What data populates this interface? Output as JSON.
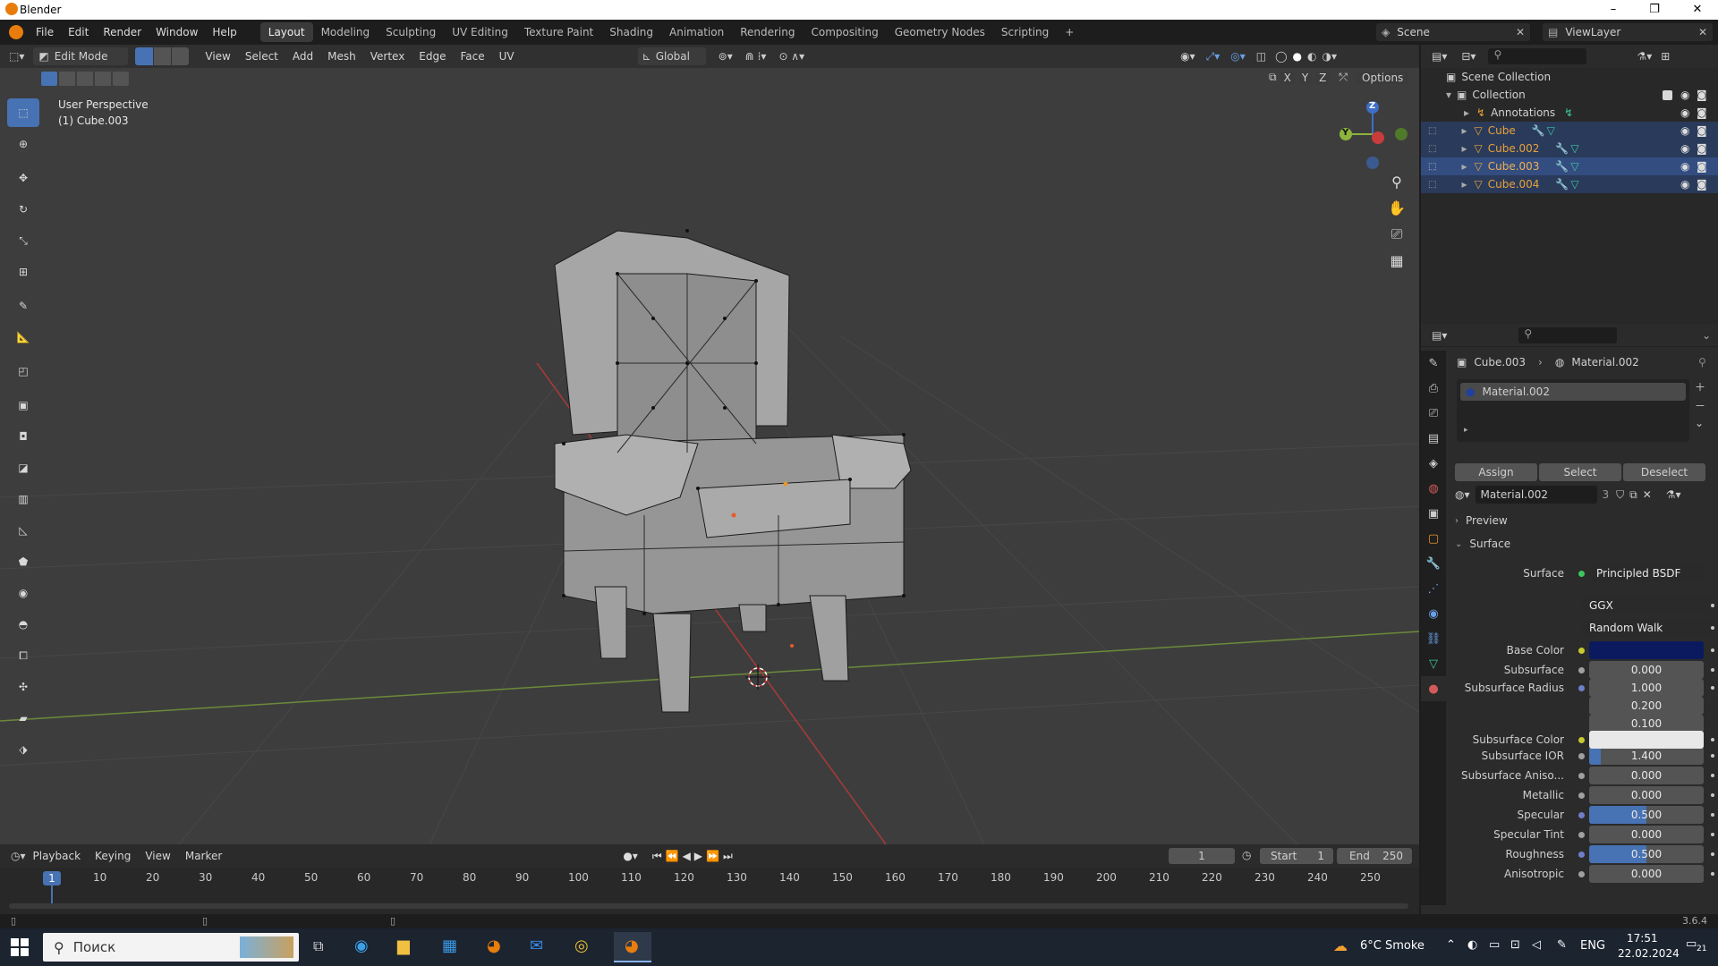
{
  "window": {
    "title": "Blender",
    "controls": [
      "–",
      "❐",
      "✕"
    ]
  },
  "menubar": {
    "menus": [
      "File",
      "Edit",
      "Render",
      "Window",
      "Help"
    ],
    "workspaces": [
      "Layout",
      "Modeling",
      "Sculpting",
      "UV Editing",
      "Texture Paint",
      "Shading",
      "Animation",
      "Rendering",
      "Compositing",
      "Geometry Nodes",
      "Scripting"
    ],
    "active_workspace": "Layout",
    "add_tab": "+",
    "scene": "Scene",
    "view_layer": "ViewLayer"
  },
  "viewport_header": {
    "mode": "Edit Mode",
    "menus": [
      "View",
      "Select",
      "Add",
      "Mesh",
      "Vertex",
      "Edge",
      "Face",
      "UV"
    ],
    "orientation": "Global",
    "options": "Options",
    "axes": [
      "X",
      "Y",
      "Z"
    ]
  },
  "viewport": {
    "perspective": "User Perspective",
    "object": "(1) Cube.003",
    "gizmo": {
      "z": "Z",
      "y": "Y"
    }
  },
  "outliner": {
    "root": "Scene Collection",
    "collection": "Collection",
    "items": [
      {
        "name": "Annotations",
        "color": "#d0d0d0",
        "selected": false
      },
      {
        "name": "Cube",
        "color": "#e8a23a",
        "selected": true
      },
      {
        "name": "Cube.002",
        "color": "#e8a23a",
        "selected": true
      },
      {
        "name": "Cube.003",
        "color": "#e8a23a",
        "selected": true,
        "active": true
      },
      {
        "name": "Cube.004",
        "color": "#e8a23a",
        "selected": true
      }
    ]
  },
  "properties": {
    "breadcrumb_object": "Cube.003",
    "breadcrumb_material": "Material.002",
    "slot": "Material.002",
    "buttons": [
      "Assign",
      "Select",
      "Deselect"
    ],
    "material_name": "Material.002",
    "users": "3",
    "panels": {
      "preview": "Preview",
      "surface": "Surface"
    },
    "surface_label": "Surface",
    "surface_shader": "Principled BSDF",
    "distribution": "GGX",
    "subsurface_method": "Random Walk",
    "base_color_label": "Base Color",
    "base_color": "#0b1a5e",
    "subsurface_color_label": "Subsurface Color",
    "subsurface_color": "#e8e8e8",
    "fields": [
      {
        "label": "Subsurface",
        "value": "0.000",
        "fill": 0
      },
      {
        "label": "Subsurface Radius",
        "value": "1.000",
        "fill": 0,
        "dot": "b"
      },
      {
        "label": "",
        "value": "0.200",
        "fill": 0
      },
      {
        "label": "",
        "value": "0.100",
        "fill": 0
      },
      {
        "label": "Subsurface IOR",
        "value": "1.400",
        "fill": 0.1
      },
      {
        "label": "Subsurface Aniso...",
        "value": "0.000",
        "fill": 0
      },
      {
        "label": "Metallic",
        "value": "0.000",
        "fill": 0
      },
      {
        "label": "Specular",
        "value": "0.500",
        "fill": 0.5,
        "dot": "b"
      },
      {
        "label": "Specular Tint",
        "value": "0.000",
        "fill": 0
      },
      {
        "label": "Roughness",
        "value": "0.500",
        "fill": 0.5,
        "dot": "b"
      },
      {
        "label": "Anisotropic",
        "value": "0.000",
        "fill": 0
      }
    ]
  },
  "timeline": {
    "menus": [
      "Playback",
      "Keying",
      "View",
      "Marker"
    ],
    "current_frame": "1",
    "start_label": "Start",
    "start": "1",
    "end_label": "End",
    "end": "250",
    "ruler": [
      "10",
      "20",
      "30",
      "40",
      "50",
      "60",
      "70",
      "80",
      "90",
      "100",
      "110",
      "120",
      "130",
      "140",
      "150",
      "160",
      "170",
      "180",
      "190",
      "200",
      "210",
      "220",
      "230",
      "240",
      "250"
    ],
    "playhead": "1"
  },
  "statusbar": {
    "version": "3.6.4"
  },
  "taskbar": {
    "search": "Поиск",
    "weather": "6°C  Smoke",
    "lang": "ENG",
    "time": "17:51",
    "date": "22.02.2024",
    "notifications": "21"
  }
}
